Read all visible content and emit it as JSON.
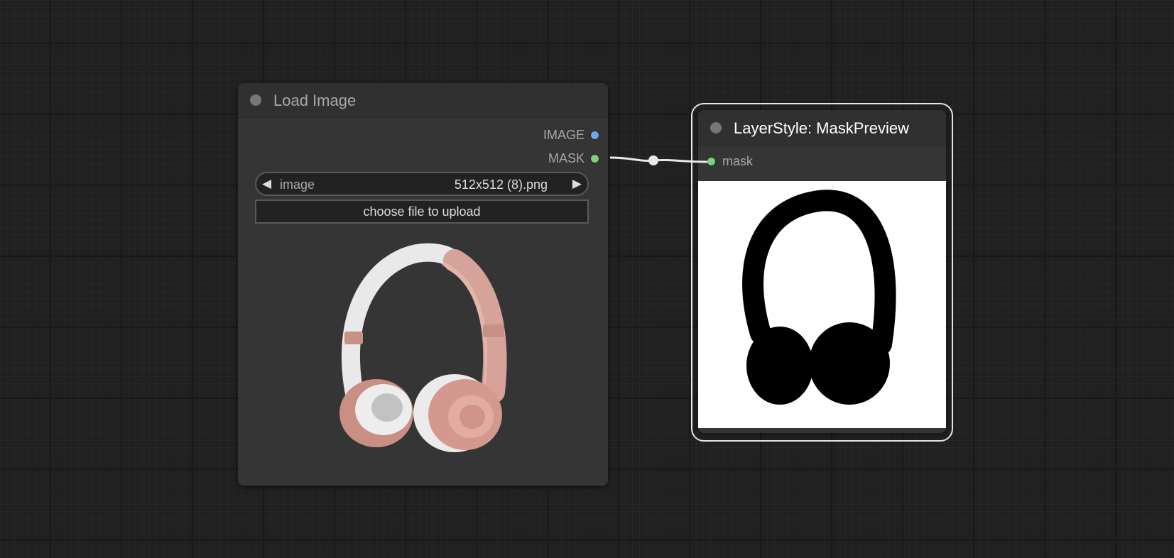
{
  "canvas": {
    "background": "#202020"
  },
  "load_image_node": {
    "title": "Load Image",
    "outputs": [
      {
        "label": "IMAGE",
        "color": "#6fa8ea"
      },
      {
        "label": "MASK",
        "color": "#7ecf7e"
      }
    ],
    "image_widget": {
      "name": "image",
      "value": "512x512 (8).png"
    },
    "upload_button": "choose file to upload",
    "preview_icon": "headphones-image"
  },
  "mask_preview_node": {
    "title": "LayerStyle: MaskPreview",
    "inputs": [
      {
        "label": "mask",
        "color": "#7ecf7e"
      }
    ],
    "preview_icon": "headphones-mask-image"
  },
  "link": {
    "color": "#e8e8e8"
  }
}
